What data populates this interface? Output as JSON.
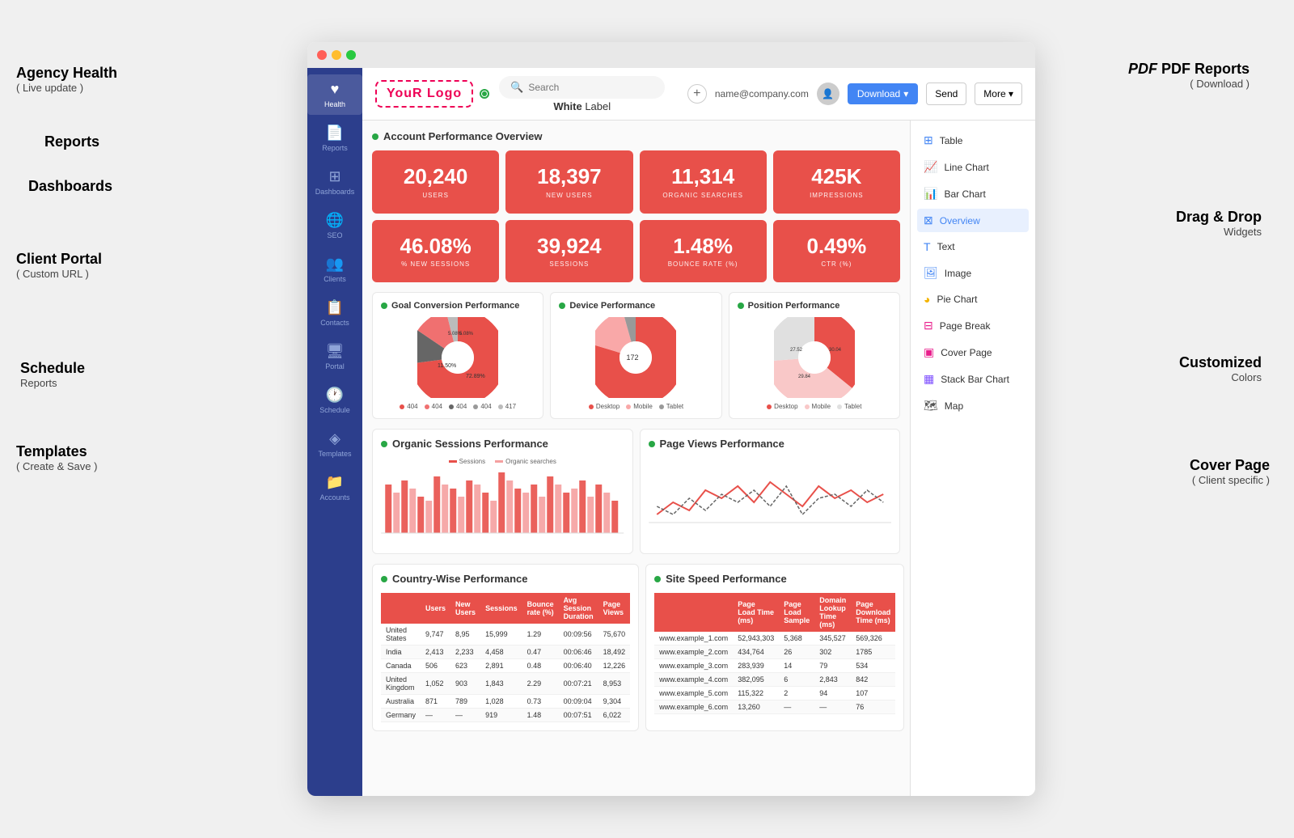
{
  "annotations": {
    "agency_health": "Agency Health",
    "live_update": "( Live update )",
    "reports": "Reports",
    "dashboards": "Dashboards",
    "client_portal": "Client Portal",
    "custom_url": "( Custom URL )",
    "schedule": "Schedule",
    "schedule_sub": "Reports",
    "templates": "Templates",
    "templates_sub": "( Create & Save )",
    "pdf_reports": "PDF Reports",
    "pdf_download": "( Download )",
    "drag_drop": "Drag & Drop",
    "widgets": "Widgets",
    "customized": "Customized",
    "colors": "Colors",
    "cover_page": "Cover Page",
    "cover_sub": "( Client specific )"
  },
  "sidebar": {
    "items": [
      {
        "label": "Health",
        "icon": "♥",
        "active": true
      },
      {
        "label": "Reports",
        "icon": "📄",
        "active": false
      },
      {
        "label": "Dashboards",
        "icon": "⊞",
        "active": false
      },
      {
        "label": "SEO",
        "icon": "🌐",
        "active": false
      },
      {
        "label": "Clients",
        "icon": "👥",
        "active": false
      },
      {
        "label": "Contacts",
        "icon": "📋",
        "active": false
      },
      {
        "label": "Portal",
        "icon": "🖥",
        "active": false
      },
      {
        "label": "Schedule",
        "icon": "🕐",
        "active": false
      },
      {
        "label": "Templates",
        "icon": "◈",
        "active": false
      },
      {
        "label": "Accounts",
        "icon": "📁",
        "active": false
      }
    ]
  },
  "topbar": {
    "logo_text": "YouR Logo",
    "white_label": "White",
    "label_suffix": " Label",
    "search_placeholder": "Search",
    "email": "name@company.com",
    "download_label": "Download",
    "send_label": "Send",
    "more_label": "More"
  },
  "report": {
    "title": "Account Performance Overview",
    "stats": [
      {
        "value": "20,240",
        "label": "USERS"
      },
      {
        "value": "18,397",
        "label": "NEW USERS"
      },
      {
        "value": "11,314",
        "label": "ORGANIC SEARCHES"
      },
      {
        "value": "425K",
        "label": "IMPRESSIONS"
      },
      {
        "value": "46.08%",
        "label": "% NEW SESSIONS"
      },
      {
        "value": "39,924",
        "label": "SESSIONS"
      },
      {
        "value": "1.48%",
        "label": "BOUNCE RATE (%)"
      },
      {
        "value": "0.49%",
        "label": "CTR (%)"
      }
    ],
    "charts": [
      {
        "title": "Goal Conversion Performance",
        "type": "pie",
        "legend": [
          {
            "color": "#e8504a",
            "label": "404"
          },
          {
            "color": "#f07070",
            "label": "404"
          },
          {
            "color": "#666",
            "label": "404"
          },
          {
            "color": "#999",
            "label": "404"
          },
          {
            "color": "#bbb",
            "label": "417"
          }
        ],
        "labels": [
          "72.89%",
          "11.50%",
          "5.08%",
          "5.08%"
        ]
      },
      {
        "title": "Device Performance",
        "type": "pie",
        "legend": [
          {
            "color": "#e8504a",
            "label": "Desktop"
          },
          {
            "color": "#f9a8a8",
            "label": "Mobile"
          },
          {
            "color": "#999",
            "label": "Tablet"
          }
        ]
      },
      {
        "title": "Position Performance",
        "type": "pie",
        "legend": [
          {
            "color": "#e8504a",
            "label": "Desktop"
          },
          {
            "color": "#f9a8a8",
            "label": "Mobile"
          },
          {
            "color": "#ddd",
            "label": "Tablet"
          }
        ],
        "labels": [
          "27.52",
          "29.84",
          "30.04"
        ]
      }
    ],
    "organic": {
      "title": "Organic Sessions Performance",
      "legend": [
        "Sessions",
        "Organic searches"
      ]
    },
    "pageviews": {
      "title": "Page Views Performance"
    },
    "country": {
      "title": "Country-Wise Performance",
      "headers": [
        "Users",
        "New Users",
        "Sessions",
        "Bounce rate (%)",
        "Avg Session Duration",
        "Page Views"
      ],
      "rows": [
        [
          "United States",
          "9,747",
          "8,95",
          "15,999",
          "1.29",
          "00:09:56",
          "75,670"
        ],
        [
          "India",
          "2,413",
          "2,233",
          "4,458",
          "0.47",
          "00:06:46",
          "18,492"
        ],
        [
          "Canada",
          "506",
          "623",
          "2,891",
          "0.48",
          "00:06:40",
          "12,226"
        ],
        [
          "United Kingdom",
          "1,052",
          "903",
          "1,843",
          "2.29",
          "00:07:21",
          "8,953"
        ],
        [
          "Australia",
          "871",
          "789",
          "1,028",
          "0.73",
          "00:09:04",
          "9,304"
        ],
        [
          "Germany",
          "—",
          "—",
          "919",
          "1.48",
          "00:07:51",
          "6,022"
        ]
      ]
    },
    "site_speed": {
      "title": "Site Speed Performance",
      "headers": [
        "Page Load Time (ms)",
        "Page Load Sample",
        "Domain Lookup Time (ms)",
        "Page Download Time (ms)"
      ],
      "rows": [
        [
          "www.example_1.com",
          "52,943,303",
          "5,368",
          "345,527",
          "569,326"
        ],
        [
          "www.example_2.com",
          "434,764",
          "26",
          "302",
          "1785"
        ],
        [
          "www.example_3.com",
          "283,939",
          "14",
          "79",
          "534"
        ],
        [
          "www.example_4.com",
          "382,095",
          "6",
          "2,843",
          "842"
        ],
        [
          "www.example_5.com",
          "115,322",
          "2",
          "94",
          "107"
        ],
        [
          "www.example_6.com",
          "13,260",
          "—",
          "—",
          "76"
        ]
      ]
    }
  },
  "widgets": {
    "items": [
      {
        "label": "Table",
        "icon": "table"
      },
      {
        "label": "Line Chart",
        "icon": "linechart"
      },
      {
        "label": "Bar Chart",
        "icon": "barchart"
      },
      {
        "label": "Overview",
        "icon": "overview",
        "active": true
      },
      {
        "label": "Text",
        "icon": "text"
      },
      {
        "label": "Image",
        "icon": "image"
      },
      {
        "label": "Pie Chart",
        "icon": "piechart"
      },
      {
        "label": "Page Break",
        "icon": "pagebreak"
      },
      {
        "label": "Cover Page",
        "icon": "coverpage"
      },
      {
        "label": "Stack Bar Chart",
        "icon": "stackbar"
      },
      {
        "label": "Map",
        "icon": "map"
      }
    ]
  }
}
